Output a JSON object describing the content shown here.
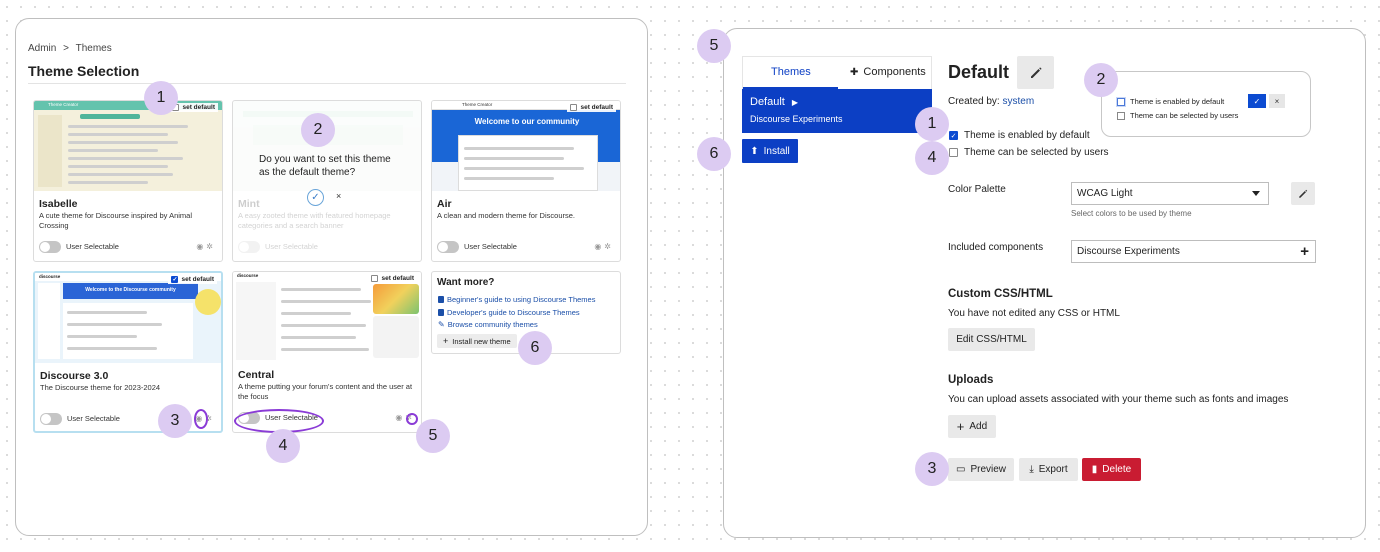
{
  "left": {
    "breadcrumb": {
      "admin": "Admin",
      "separator": ">",
      "current": "Themes"
    },
    "title": "Theme Selection",
    "set_default_label": "set default",
    "user_selectable_label": "User Selectable",
    "cards": [
      {
        "name": "Isabelle",
        "description": "A cute theme for Discourse inspired by Animal Crossing",
        "preview_title": "Theme Creator"
      },
      {
        "name": "Mint",
        "description": "A easy zooted theme with featured homepage categories and a search banner",
        "confirm_question": "Do you want to set this theme as the default theme?",
        "confirm_ok": "✓",
        "confirm_cancel": "×"
      },
      {
        "name": "Air",
        "description": "A clean and modern theme for Discourse.",
        "preview_title": "Theme Creator",
        "preview_banner": "Welcome to our community"
      },
      {
        "name": "Discourse 3.0",
        "description": "The Discourse theme for 2023-2024",
        "preview_banner": "Welcome to the Discourse community",
        "preview_logo": "discourse"
      },
      {
        "name": "Central",
        "description": "A theme putting your forum's content and the user at the focus",
        "preview_logo": "discourse"
      }
    ],
    "want_more": {
      "title": "Want more?",
      "links": [
        "Beginner's guide to using Discourse Themes",
        "Developer's guide to Discourse Themes",
        "Browse community themes"
      ],
      "install_label": "Install new theme"
    },
    "markers": [
      "1",
      "2",
      "3",
      "4",
      "5",
      "6"
    ]
  },
  "right": {
    "tabs": {
      "themes": "Themes",
      "components": "Components"
    },
    "theme_list": {
      "selected": "Default",
      "second": "Discourse Experiments"
    },
    "install_label": "Install",
    "title": "Default",
    "created_by_prefix": "Created by:",
    "created_by_author": "system",
    "checkbox_enabled": "Theme is enabled by default",
    "checkbox_selectable": "Theme can be selected by users",
    "popover": {
      "enabled": "Theme is enabled by default",
      "selectable": "Theme can be selected by users",
      "ok": "✓",
      "cancel": "×"
    },
    "color_palette": {
      "label": "Color Palette",
      "value": "WCAG Light",
      "helper": "Select colors to be used by theme"
    },
    "included_components": {
      "label": "Included components",
      "value": "Discourse Experiments",
      "add": "+"
    },
    "custom_css": {
      "title": "Custom CSS/HTML",
      "text": "You have not edited any CSS or HTML",
      "button": "Edit CSS/HTML"
    },
    "uploads": {
      "title": "Uploads",
      "text": "You can upload assets associated with your theme such as fonts and images",
      "button": "Add"
    },
    "actions": {
      "preview": "Preview",
      "export": "Export",
      "delete": "Delete"
    },
    "markers": [
      "1",
      "2",
      "3",
      "4",
      "5",
      "6"
    ]
  },
  "colors": {
    "primary": "#0c3fc4",
    "danger": "#c91c32",
    "marker": "#dccbf2",
    "annotation": "#8a3bd6"
  }
}
